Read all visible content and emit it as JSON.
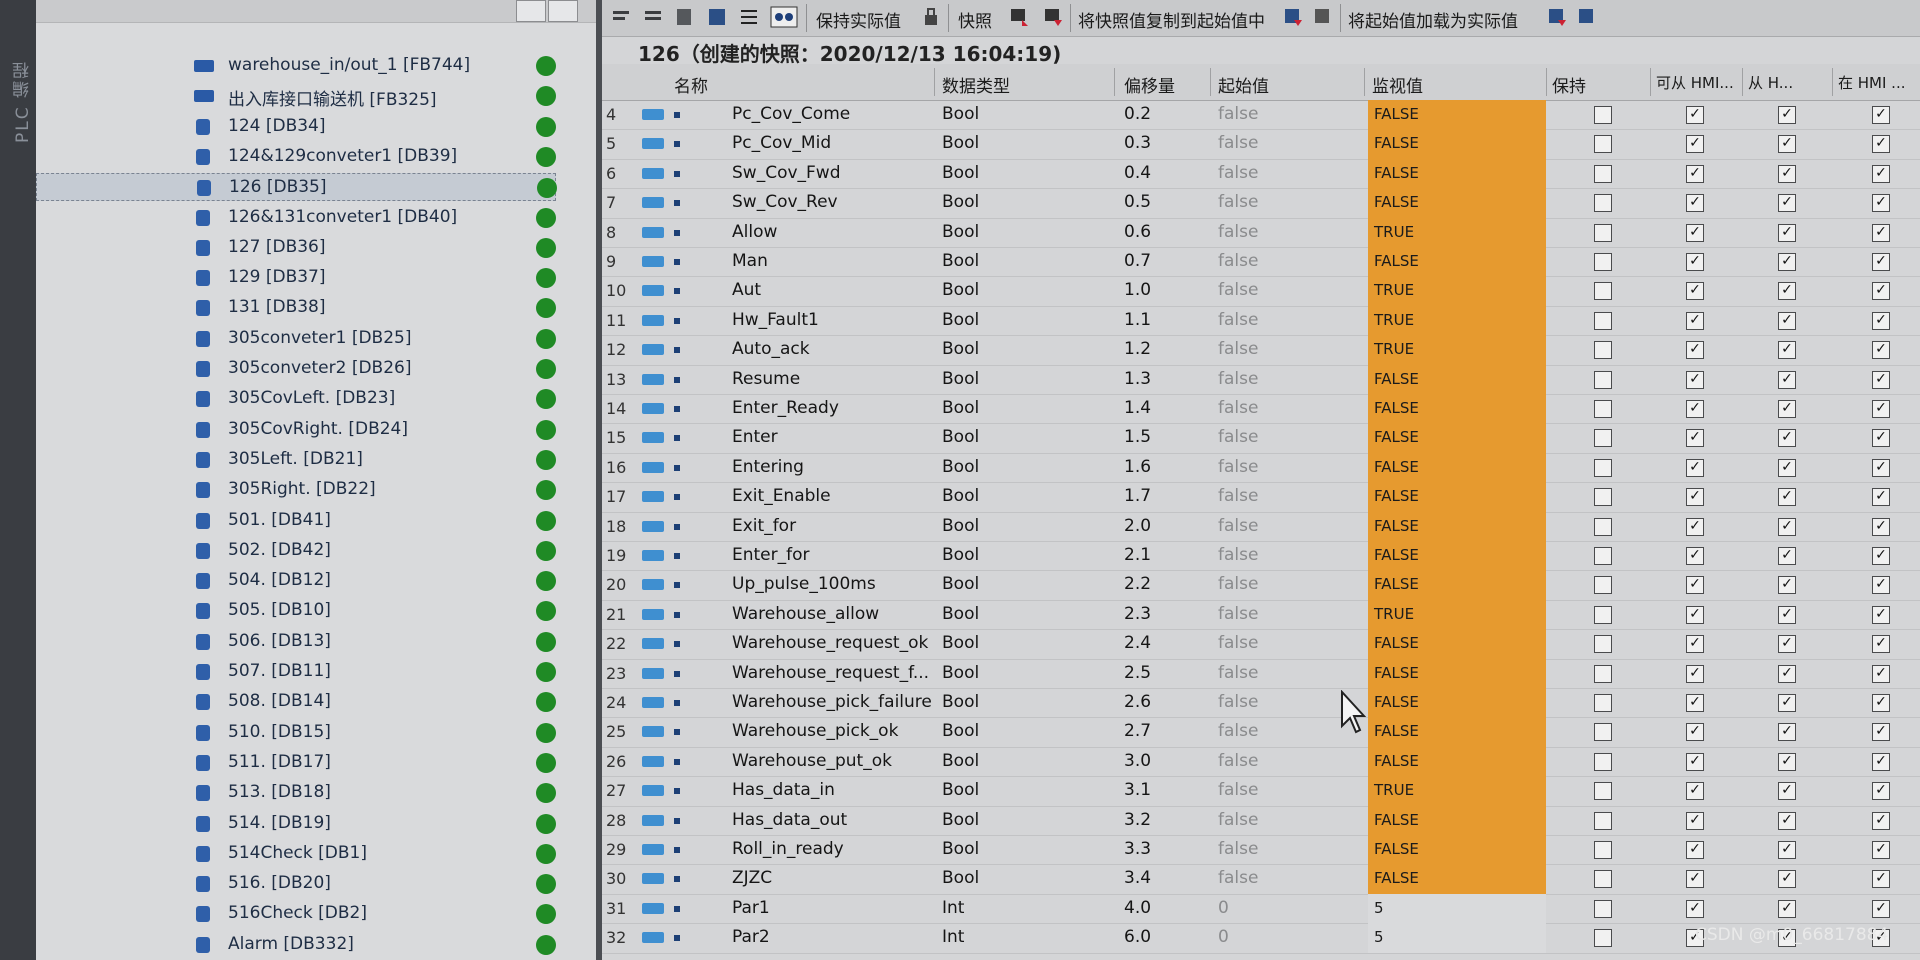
{
  "side_tab": "PLC 编程",
  "tree": {
    "items": [
      {
        "label": "warehouse_in/out_1 [FB744]",
        "type": "fb",
        "selected": false
      },
      {
        "label": "出入库接口输送机 [FB325]",
        "type": "fb",
        "selected": false
      },
      {
        "label": "124 [DB34]",
        "type": "db",
        "selected": false
      },
      {
        "label": "124&129conveter1 [DB39]",
        "type": "db",
        "selected": false
      },
      {
        "label": "126 [DB35]",
        "type": "db",
        "selected": true
      },
      {
        "label": "126&131conveter1 [DB40]",
        "type": "db",
        "selected": false
      },
      {
        "label": "127 [DB36]",
        "type": "db",
        "selected": false
      },
      {
        "label": "129 [DB37]",
        "type": "db",
        "selected": false
      },
      {
        "label": "131 [DB38]",
        "type": "db",
        "selected": false
      },
      {
        "label": "305conveter1 [DB25]",
        "type": "db",
        "selected": false
      },
      {
        "label": "305conveter2 [DB26]",
        "type": "db",
        "selected": false
      },
      {
        "label": "305CovLeft. [DB23]",
        "type": "db",
        "selected": false
      },
      {
        "label": "305CovRight. [DB24]",
        "type": "db",
        "selected": false
      },
      {
        "label": "305Left. [DB21]",
        "type": "db",
        "selected": false
      },
      {
        "label": "305Right. [DB22]",
        "type": "db",
        "selected": false
      },
      {
        "label": "501. [DB41]",
        "type": "db",
        "selected": false
      },
      {
        "label": "502. [DB42]",
        "type": "db",
        "selected": false
      },
      {
        "label": "504. [DB12]",
        "type": "db",
        "selected": false
      },
      {
        "label": "505. [DB10]",
        "type": "db",
        "selected": false
      },
      {
        "label": "506. [DB13]",
        "type": "db",
        "selected": false
      },
      {
        "label": "507. [DB11]",
        "type": "db",
        "selected": false
      },
      {
        "label": "508. [DB14]",
        "type": "db",
        "selected": false
      },
      {
        "label": "510. [DB15]",
        "type": "db",
        "selected": false
      },
      {
        "label": "511. [DB17]",
        "type": "db",
        "selected": false
      },
      {
        "label": "513. [DB18]",
        "type": "db",
        "selected": false
      },
      {
        "label": "514. [DB19]",
        "type": "db",
        "selected": false
      },
      {
        "label": "514Check [DB1]",
        "type": "db",
        "selected": false
      },
      {
        "label": "516. [DB20]",
        "type": "db",
        "selected": false
      },
      {
        "label": "516Check [DB2]",
        "type": "db",
        "selected": false
      },
      {
        "label": "Alarm [DB332]",
        "type": "db",
        "selected": false
      }
    ],
    "status_color": "#1f8a25"
  },
  "toolbar": {
    "keep_actual": "保持实际值",
    "snapshot": "快照",
    "copy_snapshot": "将快照值复制到起始值中",
    "load_start": "将起始值加载为实际值"
  },
  "snapshot_title": "126（创建的快照：2020/12/13 16:04:19)",
  "columns": {
    "name": "名称",
    "datatype": "数据类型",
    "offset": "偏移量",
    "start": "起始值",
    "monitor": "监视值",
    "retain": "保持",
    "hmi1": "可从 HMI...",
    "hmi2": "从 H...",
    "hmi3": "在 HMI ..."
  },
  "rows": [
    {
      "n": "4",
      "name": "Pc_Cov_Come",
      "type": "Bool",
      "offset": "0.2",
      "start": "false",
      "monitor": "FALSE"
    },
    {
      "n": "5",
      "name": "Pc_Cov_Mid",
      "type": "Bool",
      "offset": "0.3",
      "start": "false",
      "monitor": "FALSE"
    },
    {
      "n": "6",
      "name": "Sw_Cov_Fwd",
      "type": "Bool",
      "offset": "0.4",
      "start": "false",
      "monitor": "FALSE"
    },
    {
      "n": "7",
      "name": "Sw_Cov_Rev",
      "type": "Bool",
      "offset": "0.5",
      "start": "false",
      "monitor": "FALSE"
    },
    {
      "n": "8",
      "name": "Allow",
      "type": "Bool",
      "offset": "0.6",
      "start": "false",
      "monitor": "TRUE"
    },
    {
      "n": "9",
      "name": "Man",
      "type": "Bool",
      "offset": "0.7",
      "start": "false",
      "monitor": "FALSE"
    },
    {
      "n": "10",
      "name": "Aut",
      "type": "Bool",
      "offset": "1.0",
      "start": "false",
      "monitor": "TRUE"
    },
    {
      "n": "11",
      "name": "Hw_Fault1",
      "type": "Bool",
      "offset": "1.1",
      "start": "false",
      "monitor": "TRUE"
    },
    {
      "n": "12",
      "name": "Auto_ack",
      "type": "Bool",
      "offset": "1.2",
      "start": "false",
      "monitor": "TRUE"
    },
    {
      "n": "13",
      "name": "Resume",
      "type": "Bool",
      "offset": "1.3",
      "start": "false",
      "monitor": "FALSE"
    },
    {
      "n": "14",
      "name": "Enter_Ready",
      "type": "Bool",
      "offset": "1.4",
      "start": "false",
      "monitor": "FALSE"
    },
    {
      "n": "15",
      "name": "Enter",
      "type": "Bool",
      "offset": "1.5",
      "start": "false",
      "monitor": "FALSE"
    },
    {
      "n": "16",
      "name": "Entering",
      "type": "Bool",
      "offset": "1.6",
      "start": "false",
      "monitor": "FALSE"
    },
    {
      "n": "17",
      "name": "Exit_Enable",
      "type": "Bool",
      "offset": "1.7",
      "start": "false",
      "monitor": "FALSE"
    },
    {
      "n": "18",
      "name": "Exit_for",
      "type": "Bool",
      "offset": "2.0",
      "start": "false",
      "monitor": "FALSE"
    },
    {
      "n": "19",
      "name": "Enter_for",
      "type": "Bool",
      "offset": "2.1",
      "start": "false",
      "monitor": "FALSE"
    },
    {
      "n": "20",
      "name": "Up_pulse_100ms",
      "type": "Bool",
      "offset": "2.2",
      "start": "false",
      "monitor": "FALSE"
    },
    {
      "n": "21",
      "name": "Warehouse_allow",
      "type": "Bool",
      "offset": "2.3",
      "start": "false",
      "monitor": "TRUE"
    },
    {
      "n": "22",
      "name": "Warehouse_request_ok",
      "type": "Bool",
      "offset": "2.4",
      "start": "false",
      "monitor": "FALSE"
    },
    {
      "n": "23",
      "name": "Warehouse_request_f...",
      "type": "Bool",
      "offset": "2.5",
      "start": "false",
      "monitor": "FALSE"
    },
    {
      "n": "24",
      "name": "Warehouse_pick_failure",
      "type": "Bool",
      "offset": "2.6",
      "start": "false",
      "monitor": "FALSE"
    },
    {
      "n": "25",
      "name": "Warehouse_pick_ok",
      "type": "Bool",
      "offset": "2.7",
      "start": "false",
      "monitor": "FALSE"
    },
    {
      "n": "26",
      "name": "Warehouse_put_ok",
      "type": "Bool",
      "offset": "3.0",
      "start": "false",
      "monitor": "FALSE"
    },
    {
      "n": "27",
      "name": "Has_data_in",
      "type": "Bool",
      "offset": "3.1",
      "start": "false",
      "monitor": "TRUE"
    },
    {
      "n": "28",
      "name": "Has_data_out",
      "type": "Bool",
      "offset": "3.2",
      "start": "false",
      "monitor": "FALSE"
    },
    {
      "n": "29",
      "name": "Roll_in_ready",
      "type": "Bool",
      "offset": "3.3",
      "start": "false",
      "monitor": "FALSE"
    },
    {
      "n": "30",
      "name": "ZJZC",
      "type": "Bool",
      "offset": "3.4",
      "start": "false",
      "monitor": "FALSE"
    },
    {
      "n": "31",
      "name": "Par1",
      "type": "Int",
      "offset": "4.0",
      "start": "0",
      "monitor": "5"
    },
    {
      "n": "32",
      "name": "Par2",
      "type": "Int",
      "offset": "6.0",
      "start": "0",
      "monitor": "5"
    }
  ],
  "monitor_color": "#e69a2f",
  "watermark": "CSDN @m0_66817884"
}
